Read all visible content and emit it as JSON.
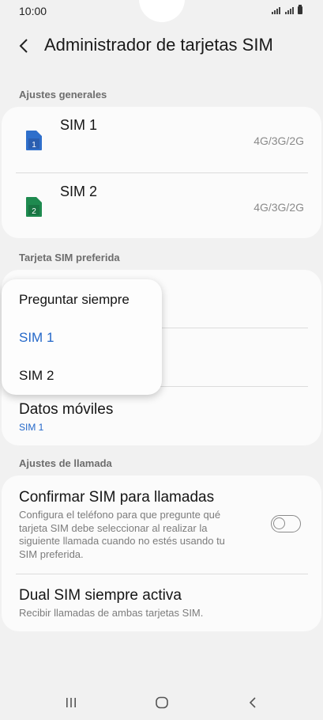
{
  "status_bar": {
    "time": "10:00"
  },
  "header": {
    "title": "Administrador de tarjetas SIM"
  },
  "general": {
    "label": "Ajustes generales",
    "sims": [
      {
        "name": "SIM 1",
        "badge": "1",
        "network": "4G/3G/2G",
        "color": "#2f6fcb"
      },
      {
        "name": "SIM 2",
        "badge": "2",
        "network": "4G/3G/2G",
        "color": "#1e8a4f"
      }
    ]
  },
  "preferred": {
    "label": "Tarjeta SIM preferida",
    "dropdown": {
      "options": [
        "Preguntar siempre",
        "SIM 1",
        "SIM 2"
      ],
      "selected": "SIM 1"
    },
    "mobile_data": {
      "title": "Datos móviles",
      "value": "SIM 1"
    }
  },
  "calls": {
    "label": "Ajustes de llamada",
    "confirm": {
      "title": "Confirmar SIM para llamadas",
      "desc_lines": [
        "Configura el teléfono para que pregunte qué",
        "tarjeta SIM debe seleccionar al realizar la",
        "siguiente llamada cuando no estés usando tu",
        "SIM preferida."
      ],
      "enabled": false
    },
    "dual": {
      "title": "Dual SIM siempre activa",
      "desc": "Recibir llamadas de ambas tarjetas SIM."
    }
  },
  "colors": {
    "accent": "#2468c9",
    "background": "#f1f1f1",
    "card": "#fbfbfb"
  },
  "nav": {
    "icons": [
      "recents-icon",
      "home-icon",
      "back-icon"
    ]
  }
}
